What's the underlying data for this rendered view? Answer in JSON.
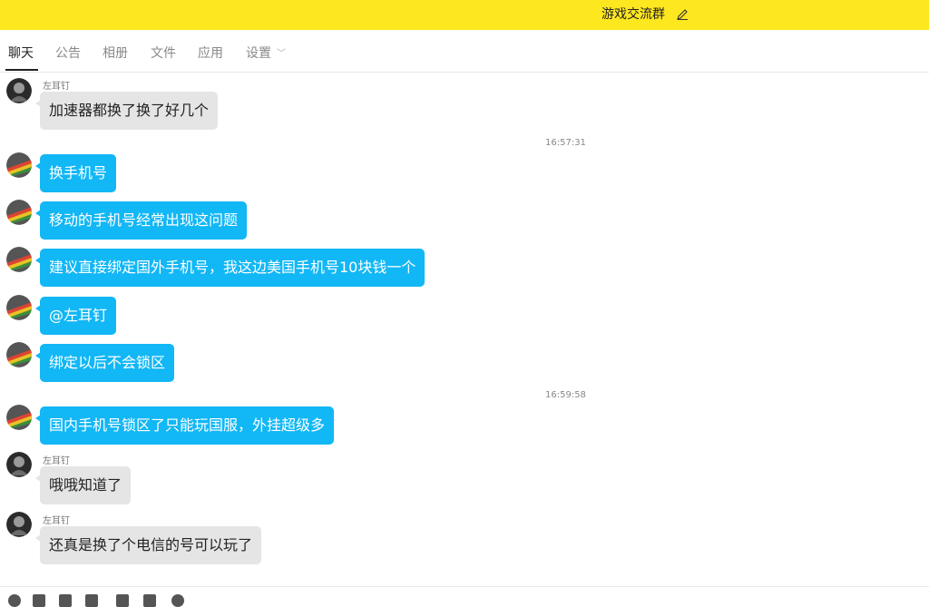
{
  "header": {
    "title": "游戏交流群",
    "edit_icon": "pencil-icon",
    "bg_color": "#fde71f"
  },
  "tabs": [
    {
      "label": "聊天",
      "active": true
    },
    {
      "label": "公告"
    },
    {
      "label": "相册"
    },
    {
      "label": "文件"
    },
    {
      "label": "应用"
    },
    {
      "label": "设置"
    }
  ],
  "messages": [
    {
      "sender": "左耳钉",
      "text": "加速器都换了换了好几个",
      "style": "gray"
    },
    {
      "time": "16:57:31"
    },
    {
      "text": "换手机号",
      "style": "blue"
    },
    {
      "text": "移动的手机号经常出现这问题",
      "style": "blue"
    },
    {
      "text": "建议直接绑定国外手机号，我这边美国手机号10块钱一个",
      "style": "blue"
    },
    {
      "text": "@左耳钉",
      "style": "blue"
    },
    {
      "text": "绑定以后不会锁区",
      "style": "blue"
    },
    {
      "time": "16:59:58"
    },
    {
      "text": "国内手机号锁区了只能玩国服，外挂超级多",
      "style": "blue"
    },
    {
      "sender": "左耳钉",
      "text": "哦哦知道了",
      "style": "gray"
    },
    {
      "sender": "左耳钉",
      "text": "还真是换了个电信的号可以玩了",
      "style": "gray"
    }
  ],
  "colors": {
    "self_bubble": "#12b7f5",
    "other_bubble": "#e5e5e5"
  },
  "toolbar_icons": [
    "emoji-icon",
    "screenshot-icon",
    "scissors-icon",
    "folder-icon",
    "file-icon",
    "image-icon",
    "bell-icon"
  ]
}
